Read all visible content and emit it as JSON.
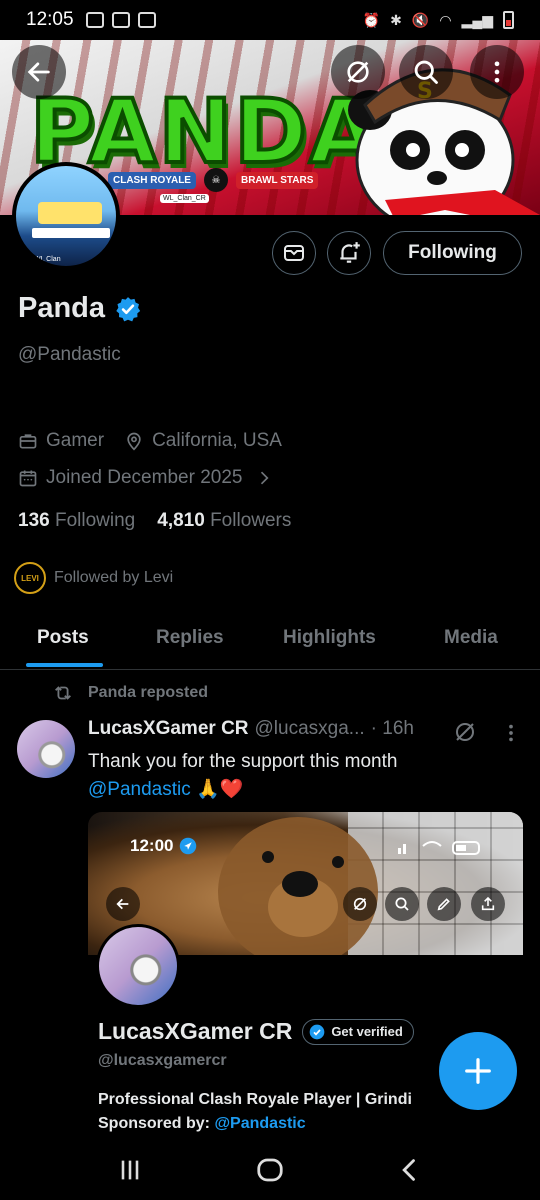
{
  "status_bar": {
    "time": "12:05"
  },
  "banner": {
    "title": "PANDA",
    "logo_clash": "CLASH ROYALE",
    "logo_brawl": "BRAWL STARS",
    "handle_tag": "WL_Clan_CR"
  },
  "avatar": {
    "label": "WL Clan"
  },
  "actions": {
    "following_label": "Following"
  },
  "profile": {
    "name": "Panda",
    "handle": "@Pandastic",
    "occupation": "Gamer",
    "location": "California, USA",
    "joined": "Joined December 2025",
    "following_count": "136",
    "following_label": "Following",
    "followers_count": "4,810",
    "followers_label": "Followers",
    "followed_by": "Followed by Levi",
    "followed_by_avatar": "LEVI"
  },
  "tabs": [
    {
      "label": "Posts"
    },
    {
      "label": "Replies"
    },
    {
      "label": "Highlights"
    },
    {
      "label": "Media"
    }
  ],
  "post": {
    "repost_label": "Panda reposted",
    "author": "LucasXGamer CR",
    "author_handle": "@lucasxga...",
    "time": "· 16h",
    "text": "Thank you for the support this month",
    "mention": "@Pandastic",
    "emoji": "🙏❤️",
    "embed": {
      "time": "12:00",
      "name": "LucasXGamer CR",
      "get_verified": "Get verified",
      "handle": "@lucasxgamercr",
      "bio_line1": "Professional Clash Royale Player | Grindi",
      "bio_line2_prefix": "Sponsored by: ",
      "bio_line2_mention": "@Pandastic"
    }
  },
  "colors": {
    "accent": "#1d9bf0",
    "background": "#000000",
    "muted": "#71767b"
  }
}
